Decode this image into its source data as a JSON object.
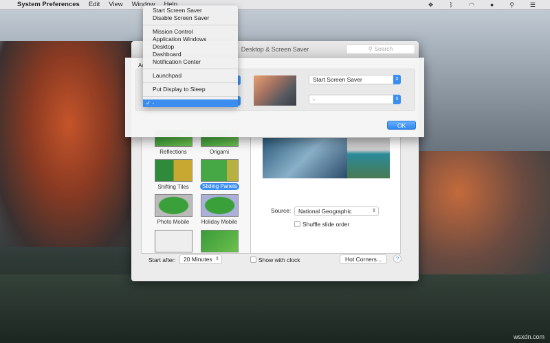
{
  "menubar": {
    "app": "System Preferences",
    "items": [
      "Edit",
      "View",
      "Window",
      "Help"
    ],
    "status_icons": [
      "dropbox-icon",
      "bluetooth-icon",
      "wifi-icon",
      "user-icon",
      "spotlight-icon",
      "notification-list-icon"
    ]
  },
  "window": {
    "title": "Desktop & Screen Saver",
    "search_placeholder": "Search"
  },
  "sheet": {
    "label": "Ac",
    "right_top": "Start Screen Saver",
    "right_bottom": "-",
    "ok": "OK"
  },
  "menu": {
    "groups": [
      [
        "Start Screen Saver",
        "Disable Screen Saver"
      ],
      [
        "Mission Control",
        "Application Windows",
        "Desktop",
        "Dashboard",
        "Notification Center"
      ],
      [
        "Launchpad"
      ],
      [
        "Put Display to Sleep"
      ]
    ],
    "selected": "-",
    "check": "✓"
  },
  "savers": [
    "Reflections",
    "Origami",
    "Shifting Tiles",
    "Sliding Panels",
    "Photo Mobile",
    "Holiday Mobile"
  ],
  "selected_saver": "Sliding Panels",
  "options": {
    "source_label": "Source:",
    "source_value": "National Geographic",
    "shuffle": "Shuffle slide order",
    "shuffle_checked": false
  },
  "bottom": {
    "start_after_label": "Start after:",
    "start_after_value": "20 Minutes",
    "show_clock": "Show with clock",
    "show_clock_checked": false,
    "hot_corners": "Hot Corners...",
    "help": "?"
  },
  "watermark": "wsxdn.com",
  "colors": {
    "accent": "#3b8ef0"
  }
}
